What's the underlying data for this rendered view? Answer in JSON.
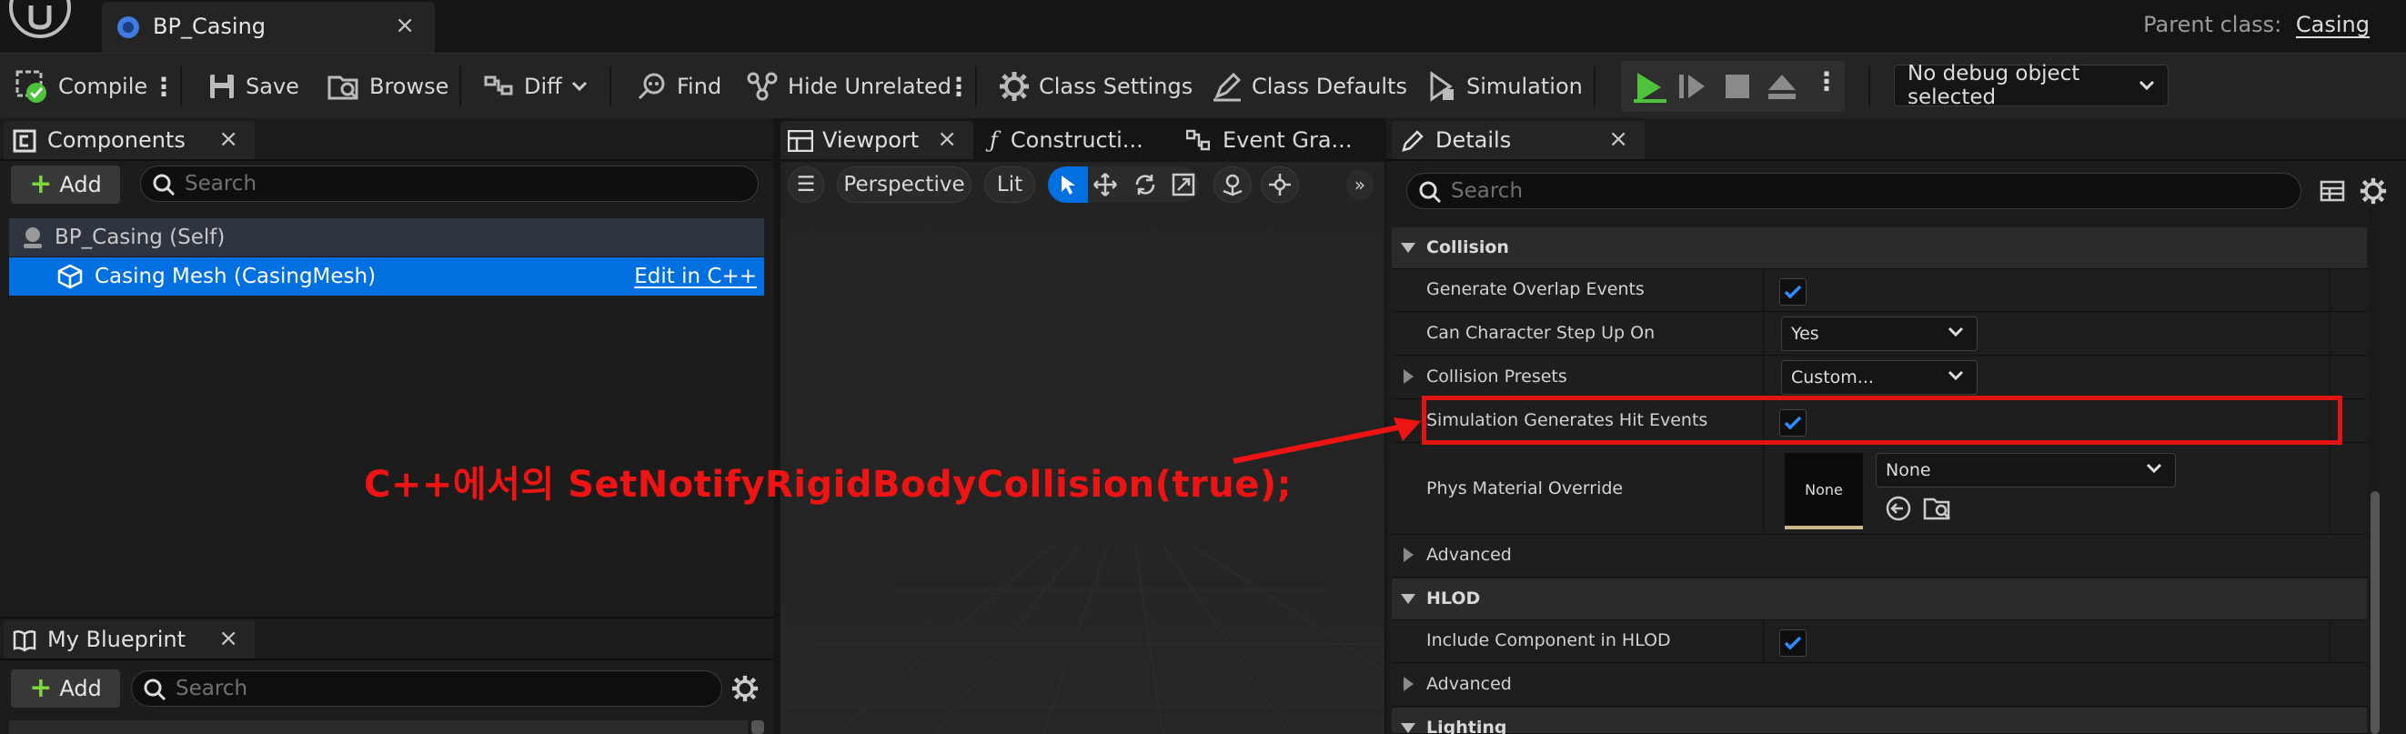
{
  "asset_tab": {
    "title": "BP_Casing",
    "close": "×"
  },
  "parent_class": {
    "label": "Parent class:",
    "value": "Casing"
  },
  "toolbar": {
    "compile": "Compile",
    "save": "Save",
    "browse": "Browse",
    "diff": "Diff",
    "find": "Find",
    "hide_unrelated": "Hide Unrelated",
    "class_settings": "Class Settings",
    "class_defaults": "Class Defaults",
    "simulation": "Simulation",
    "debug_object": "No debug object selected"
  },
  "components_panel": {
    "tab": "Components",
    "add": "Add",
    "search_placeholder": "Search",
    "items": [
      {
        "label": "BP_Casing (Self)"
      },
      {
        "label": "Casing Mesh (CasingMesh)",
        "link": "Edit in C++",
        "selected": true
      }
    ]
  },
  "my_blueprint_panel": {
    "tab": "My Blueprint",
    "add": "Add",
    "search_placeholder": "Search"
  },
  "editor_tabs": {
    "viewport": "Viewport",
    "construction": "Constructi...",
    "event_graph": "Event Gra..."
  },
  "viewport": {
    "perspective": "Perspective",
    "lit": "Lit"
  },
  "details_panel": {
    "tab": "Details",
    "search_placeholder": "Search",
    "collision": {
      "header": "Collision",
      "generate_overlap": "Generate Overlap Events",
      "char_step_up": "Can Character Step Up On",
      "char_step_up_value": "Yes",
      "presets": "Collision Presets",
      "presets_value": "Custom...",
      "sim_hit_events": "Simulation Generates Hit Events",
      "phys_material": "Phys Material Override",
      "phys_material_thumb": "None",
      "phys_material_value": "None",
      "advanced": "Advanced"
    },
    "hlod": {
      "header": "HLOD",
      "include": "Include Component in HLOD",
      "advanced": "Advanced"
    },
    "lighting": {
      "header": "Lighting"
    }
  },
  "annotation": "C++에서의 SetNotifyRigidBodyCollision(true);",
  "colors": {
    "accent_blue": "#0070e0",
    "annotation_red": "#ef1414",
    "play_green": "#4ec23a"
  }
}
